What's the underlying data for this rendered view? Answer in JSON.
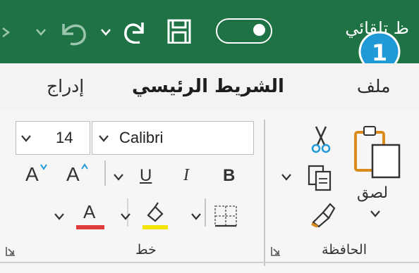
{
  "titlebar": {
    "autosave_label": "ظ تلقائي",
    "bg_color": "#1f7244",
    "icons": [
      "undo-icon",
      "redo-icon",
      "save-icon",
      "dropdown-icon"
    ]
  },
  "callout": {
    "number": "1",
    "color": "#1f9ad6"
  },
  "tabs": {
    "file": "ملف",
    "home": "الشريط الرئيسي",
    "insert": "إدراج",
    "active": "home"
  },
  "clipboard": {
    "paste_label": "لصق",
    "group_label": "الحافظة",
    "icons": [
      "paste-icon",
      "cut-icon",
      "copy-icon",
      "format-painter-icon"
    ]
  },
  "font": {
    "name": "Calibri",
    "size": "14",
    "bold": "B",
    "italic": "I",
    "underline": "U",
    "grow": "A",
    "shrink": "A",
    "font_color_letter": "A",
    "group_label": "خط",
    "font_color": "#e03a3a",
    "highlight_color": "#f2e600"
  }
}
